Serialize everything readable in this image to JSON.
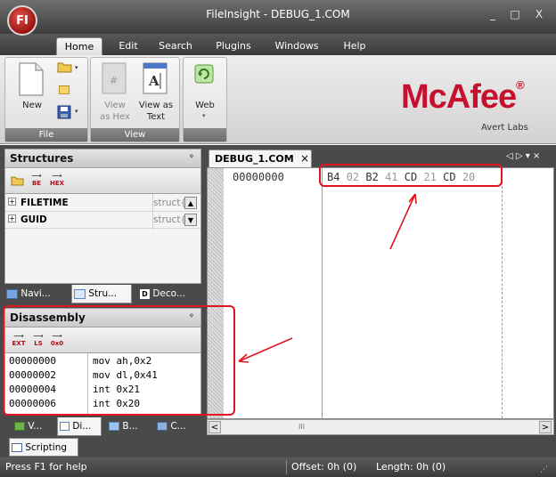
{
  "window": {
    "title": "FileInsight - DEBUG_1.COM",
    "orb_label": "FI",
    "minimize": "_",
    "maximize": "□",
    "close": "X"
  },
  "ribbon_tabs": [
    "Home",
    "Edit",
    "Search",
    "Plugins",
    "Windows",
    "Help"
  ],
  "ribbon": {
    "file_group": {
      "label": "File",
      "new_label": "New"
    },
    "view_group": {
      "label": "View",
      "view_as_hex": "View\nas Hex",
      "view_as_text": "View as\nText"
    },
    "web_group": {
      "web_label": "Web"
    }
  },
  "branding": {
    "logo": "McAfee",
    "registered": "®",
    "sub": "Avert Labs"
  },
  "structures": {
    "title": "Structures",
    "pin": "ᵠ",
    "toolbar": {
      "be": "BE",
      "hex": "HEX"
    },
    "rows": [
      {
        "expand": "+",
        "name": "FILETIME",
        "type": "struct{"
      },
      {
        "expand": "+",
        "name": "GUID",
        "type": "struct{"
      }
    ]
  },
  "left_tabs_top": [
    "Navi...",
    "Stru...",
    "Deco..."
  ],
  "disassembly": {
    "title": "Disassembly",
    "pin": "ᵠ",
    "toolbar": {
      "ext": "EXT",
      "ls": "LS",
      "zero": "0x0"
    },
    "rows": [
      {
        "addr": "00000000",
        "instr": "mov ah,0x2"
      },
      {
        "addr": "00000002",
        "instr": "mov dl,0x41"
      },
      {
        "addr": "00000004",
        "instr": "int 0x21"
      },
      {
        "addr": "00000006",
        "instr": "int 0x20"
      }
    ]
  },
  "left_tabs_bottom": [
    "V...",
    "Di...",
    "B...",
    "C..."
  ],
  "scripting_tab": "Scripting",
  "document": {
    "tab_label": "DEBUG_1.COM",
    "tab_close": "×",
    "offset": "00000000",
    "bytes": [
      {
        "hex": "B4",
        "dim": false
      },
      {
        "hex": "02",
        "dim": true
      },
      {
        "hex": "B2",
        "dim": false
      },
      {
        "hex": "41",
        "dim": true
      },
      {
        "hex": "CD",
        "dim": false
      },
      {
        "hex": "21",
        "dim": true
      },
      {
        "hex": "CD",
        "dim": false
      },
      {
        "hex": "20",
        "dim": true
      }
    ],
    "scroll_left": "<",
    "scroll_right": ">",
    "scroll_thumb": "III",
    "nav_arrows": "◁ ▷ ▾ ×"
  },
  "status": {
    "help": "Press F1 for help",
    "offset": "Offset: 0h (0)",
    "length": "Length: 0h (0)"
  },
  "colors": {
    "annotation_red": "#e0141e",
    "mcafee_red": "#c8102e"
  }
}
